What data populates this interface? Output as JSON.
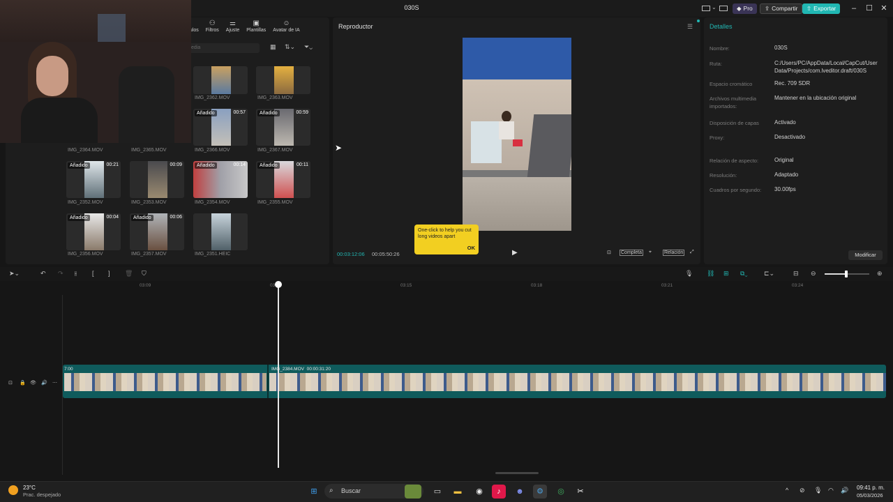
{
  "window": {
    "title": "030S",
    "pro_label": "Pro",
    "share_label": "Compartir",
    "export_label": "Exportar"
  },
  "media": {
    "tabs": [
      "ítulos",
      "Filtros",
      "Ajuste",
      "Plantillas",
      "Avatar de IA"
    ],
    "search_placeholder": "edia",
    "thumbnails": [
      {
        "name": "IMG_2362.MOV",
        "badge": "",
        "duration": ""
      },
      {
        "name": "IMG_2363.MOV",
        "badge": "",
        "duration": ""
      },
      {
        "name": "IMG_2364.MOV",
        "badge": "",
        "duration": ""
      },
      {
        "name": "IMG_2365.MOV",
        "badge": "",
        "duration": ""
      },
      {
        "name": "IMG_2366.MOV",
        "badge": "Añadido",
        "duration": "00:57"
      },
      {
        "name": "IMG_2367.MOV",
        "badge": "Añadido",
        "duration": "00:59"
      },
      {
        "name": "IMG_2352.MOV",
        "badge": "Añadido",
        "duration": "00:21"
      },
      {
        "name": "IMG_2353.MOV",
        "badge": "",
        "duration": "00:09"
      },
      {
        "name": "IMG_2354.MOV",
        "badge": "Añadido",
        "duration": "00:14"
      },
      {
        "name": "IMG_2355.MOV",
        "badge": "Añadido",
        "duration": "00:11"
      },
      {
        "name": "IMG_2356.MOV",
        "badge": "Añadido",
        "duration": "00:04"
      },
      {
        "name": "IMG_2357.MOV",
        "badge": "Añadido",
        "duration": "00:06"
      },
      {
        "name": "IMG_2351.HEIC",
        "badge": "",
        "duration": ""
      }
    ]
  },
  "player": {
    "title": "Reproductor",
    "tooltip_text": "One-click to help you cut long videos apart",
    "tooltip_ok": "OK",
    "current_time": "00:03:12:06",
    "total_time": "00:05:50:26",
    "full_label": "Completa",
    "ratio_label": "Relación"
  },
  "details": {
    "title": "Detalles",
    "rows": [
      {
        "key": "Nombre:",
        "value": "030S"
      },
      {
        "key": "Ruta:",
        "value": "C:/Users/PC/AppData/Local/CapCut/User Data/Projects/com.lveditor.draft/030S"
      },
      {
        "key": "Espacio cromático",
        "value": "Rec. 709 SDR"
      },
      {
        "key": "Archivos multimedia importados:",
        "value": "Mantener en la ubicación original"
      },
      {
        "key": "Disposición de capas",
        "value": "Activado"
      },
      {
        "key": "Proxy:",
        "value": "Desactivado"
      },
      {
        "key": "Relación de aspecto:",
        "value": "Original"
      },
      {
        "key": "Resolución:",
        "value": "Adaptado"
      },
      {
        "key": "Cuadros por segundo:",
        "value": "30.00fps"
      }
    ],
    "modify_label": "Modificar"
  },
  "timeline": {
    "ticks": [
      "03:09",
      "03:12",
      "03:15",
      "03:18",
      "03:21",
      "03:24"
    ],
    "clip1_label": "7:00",
    "clip2_name": "IMG_2384.MOV",
    "clip2_duration": "00:00:31:20"
  },
  "taskbar": {
    "temperature": "23°C",
    "weather": "Prac. despejado",
    "search_placeholder": "Buscar",
    "time": "09:41 p. m.",
    "date": "05/03/2026"
  },
  "colors": {
    "accent": "#21b7b3",
    "tooltip": "#f2cf21",
    "track": "#0f5b5c"
  }
}
